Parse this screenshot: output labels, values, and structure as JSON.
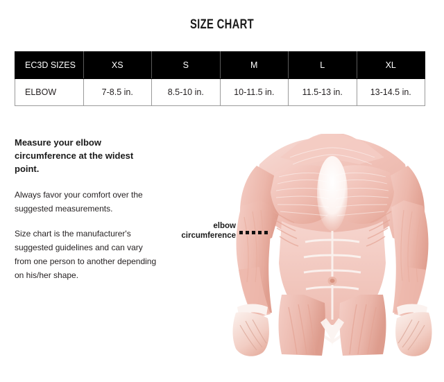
{
  "title": "SIZE CHART",
  "table": {
    "headers": [
      "EC3D SIZES",
      "XS",
      "S",
      "M",
      "L",
      "XL"
    ],
    "rows": [
      {
        "label": "ELBOW",
        "values": [
          "7-8.5 in.",
          "8.5-10 in.",
          "10-11.5 in.",
          "11.5-13 in.",
          "13-14.5 in."
        ]
      }
    ]
  },
  "instructions": {
    "heading": "Measure your elbow circumference at the widest point.",
    "paragraphs": [
      "Always favor your comfort over the suggested measurements.",
      "Size chart is the manufacturer's suggested guidelines and can vary from one person to another depending on his/her shape."
    ]
  },
  "callout": {
    "line1": "elbow",
    "line2": "circumference"
  },
  "colors": {
    "header_background": "#000000",
    "header_text": "#ffffff",
    "body_text": "#231f20",
    "table_border": "#9a9a9a",
    "muscle_light": "#f7dcd6",
    "muscle_mid": "#f0c0b6",
    "muscle_deep": "#e3a496",
    "tendon_white": "#fbf5f2",
    "page_background": "#ffffff"
  }
}
